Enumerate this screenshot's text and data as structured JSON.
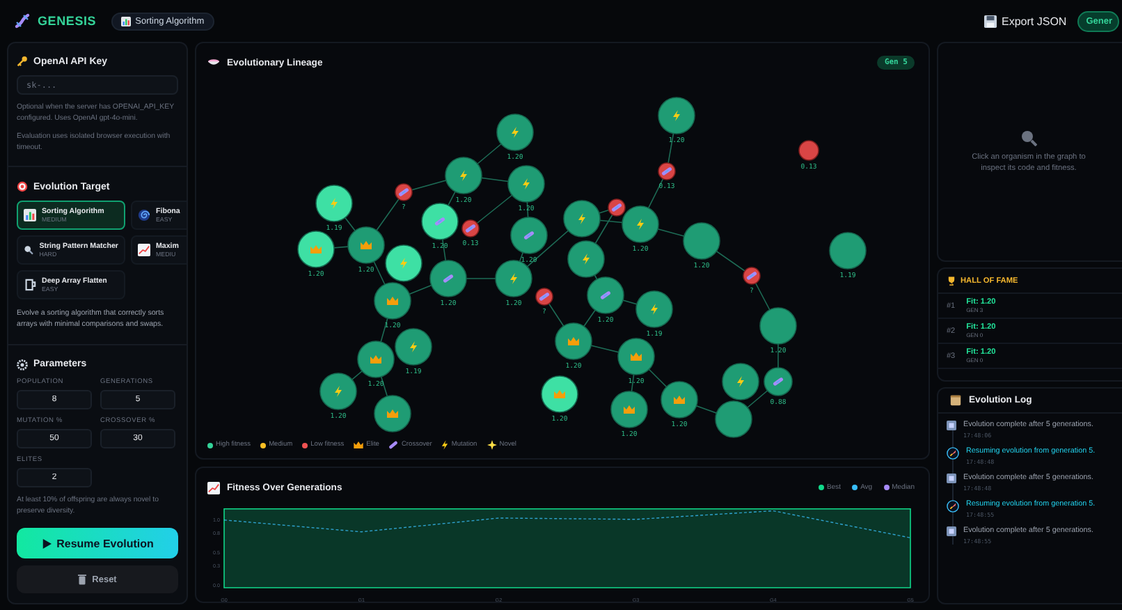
{
  "header": {
    "logo": "GENESIS",
    "task_chip": "Sorting Algorithm",
    "export_button": "Export JSON",
    "generate_button": "Gener"
  },
  "api_key": {
    "title": "OpenAI API Key",
    "placeholder": "sk-...",
    "help": "Optional when the server has OPENAI_API_KEY configured. Uses OpenAI gpt-4o-mini.",
    "note": "Evaluation uses isolated browser execution with timeout."
  },
  "target": {
    "title": "Evolution Target",
    "options": [
      {
        "name": "Sorting Algorithm",
        "difficulty": "MEDIUM",
        "selected": true
      },
      {
        "name": "Fibona",
        "difficulty": "EASY",
        "selected": false
      },
      {
        "name": "String Pattern Matcher",
        "difficulty": "HARD",
        "selected": false
      },
      {
        "name": "Maxim",
        "difficulty": "MEDIU",
        "selected": false
      },
      {
        "name": "Deep Array Flatten",
        "difficulty": "EASY",
        "selected": false
      }
    ],
    "description": "Evolve a sorting algorithm that correctly sorts arrays with minimal comparisons and swaps."
  },
  "parameters": {
    "title": "Parameters",
    "fields": [
      {
        "label": "POPULATION",
        "value": "8"
      },
      {
        "label": "GENERATIONS",
        "value": "5"
      },
      {
        "label": "MUTATION %",
        "value": "50"
      },
      {
        "label": "CROSSOVER %",
        "value": "30"
      },
      {
        "label": "ELITES",
        "value": "2"
      }
    ],
    "note": "At least 10% of offspring are always novel to preserve diversity."
  },
  "actions": {
    "resume": "Resume Evolution",
    "reset": "Reset"
  },
  "lineage": {
    "title": "Evolutionary Lineage",
    "generation_badge": "Gen 5",
    "nodes": [
      {
        "kind": "mutation",
        "low": false,
        "highlighted": false,
        "label": "1.20"
      },
      {
        "kind": "mutation",
        "low": false,
        "highlighted": false,
        "label": "1.20"
      },
      {
        "kind": "mutation",
        "low": false,
        "highlighted": false,
        "label": "1.20"
      },
      {
        "kind": "crossover",
        "low": true,
        "highlighted": false,
        "label": "?"
      },
      {
        "kind": "mutation",
        "low": false,
        "highlighted": true,
        "label": "1.19"
      },
      {
        "kind": "crossover",
        "low": false,
        "highlighted": true,
        "label": "1.20"
      },
      {
        "kind": "crossover",
        "low": true,
        "highlighted": false,
        "label": "0.13"
      },
      {
        "kind": "crossover",
        "low": false,
        "highlighted": false,
        "label": "1.20"
      },
      {
        "kind": "elite",
        "low": false,
        "highlighted": true,
        "label": "1.20"
      },
      {
        "kind": "elite",
        "low": false,
        "highlighted": false,
        "label": "1.20"
      },
      {
        "kind": "mutation",
        "low": false,
        "highlighted": true
      },
      {
        "kind": "crossover",
        "low": false,
        "highlighted": false,
        "label": "1.20"
      },
      {
        "kind": "mutation",
        "low": false,
        "highlighted": false,
        "label": "1.20"
      },
      {
        "kind": "crossover",
        "low": true,
        "highlighted": false,
        "label": "?"
      },
      {
        "kind": "elite",
        "low": false,
        "highlighted": false,
        "label": "1.20"
      },
      {
        "kind": "mutation",
        "low": false,
        "highlighted": false,
        "label": "1.19"
      },
      {
        "kind": "elite",
        "low": false,
        "highlighted": false,
        "label": "1.20"
      },
      {
        "kind": "mutation",
        "low": false,
        "highlighted": false,
        "label": "1.20"
      },
      {
        "kind": "elite",
        "low": false,
        "highlighted": false
      },
      {
        "kind": "mutation",
        "low": false,
        "highlighted": false,
        "label": "1.20"
      },
      {
        "kind": "crossover",
        "low": true,
        "highlighted": false,
        "label": "0.13"
      },
      {
        "kind": "none",
        "low": true,
        "highlighted": false,
        "label": "0.13"
      },
      {
        "kind": "mutation",
        "low": false,
        "highlighted": false
      },
      {
        "kind": "crossover",
        "low": true,
        "highlighted": false
      },
      {
        "kind": "mutation",
        "low": false,
        "highlighted": false,
        "label": "1.20"
      },
      {
        "kind": "mutation",
        "low": false,
        "highlighted": false
      },
      {
        "kind": "none",
        "low": false,
        "highlighted": false,
        "label": "1.20"
      },
      {
        "kind": "crossover",
        "low": true,
        "highlighted": false,
        "label": "?"
      },
      {
        "kind": "none",
        "low": false,
        "highlighted": false,
        "label": "1.19"
      },
      {
        "kind": "crossover",
        "low": false,
        "highlighted": false,
        "label": "1.20"
      },
      {
        "kind": "mutation",
        "low": false,
        "highlighted": false,
        "label": "1.19"
      },
      {
        "kind": "elite",
        "low": false,
        "highlighted": false,
        "label": "1.20"
      },
      {
        "kind": "elite",
        "low": false,
        "highlighted": false,
        "label": "1.20"
      },
      {
        "kind": "elite",
        "low": false,
        "highlighted": true,
        "label": "1.20"
      },
      {
        "kind": "elite",
        "low": false,
        "highlighted": false,
        "label": "1.20"
      },
      {
        "kind": "elite",
        "low": false,
        "highlighted": false,
        "label": "1.20"
      },
      {
        "kind": "mutation",
        "low": false,
        "highlighted": false
      },
      {
        "kind": "crossover",
        "low": false,
        "highlighted": false,
        "label": "0.88"
      },
      {
        "kind": "none",
        "low": false,
        "highlighted": false
      },
      {
        "kind": "none",
        "low": false,
        "highlighted": false,
        "label": "1.20"
      }
    ],
    "legend": [
      {
        "label": "High fitness",
        "kind": "dot",
        "color": "#34d399"
      },
      {
        "label": "Medium",
        "kind": "dot",
        "color": "#fbbf24"
      },
      {
        "label": "Low fitness",
        "kind": "dot",
        "color": "#f05252"
      },
      {
        "label": "Elite",
        "kind": "elite"
      },
      {
        "label": "Crossover",
        "kind": "crossover"
      },
      {
        "label": "Mutation",
        "kind": "mutation"
      },
      {
        "label": "Novel",
        "kind": "novel"
      }
    ]
  },
  "fitness": {
    "title": "Fitness Over Generations",
    "chart_data": {
      "type": "area",
      "categories": [
        "G0",
        "G1",
        "G2",
        "G3",
        "G4",
        "G5"
      ],
      "ylim": [
        0,
        1.25
      ],
      "yticks": [
        {
          "value": 0,
          "label": "0.0"
        },
        {
          "value": 0.3,
          "label": "0.3"
        },
        {
          "value": 0.5,
          "label": "0.5"
        },
        {
          "value": 0.8,
          "label": "0.8"
        },
        {
          "value": 1.0,
          "label": "1.0"
        }
      ],
      "series": [
        {
          "name": "Best",
          "color": "#10d98a",
          "values": [
            1.2,
            1.2,
            1.2,
            1.2,
            1.2,
            1.2
          ]
        },
        {
          "name": "Avg",
          "type": "line",
          "line_style": "dashed",
          "color": "#38bdf8",
          "values": [
            1.03,
            0.85,
            1.06,
            1.04,
            1.17,
            0.76
          ]
        },
        {
          "name": "Median",
          "type": "line",
          "color": "#a78bfa",
          "values": [
            null,
            null,
            null,
            null,
            null,
            null
          ]
        }
      ]
    }
  },
  "inspector": {
    "hint": "Click an organism in the graph to inspect its code and fitness."
  },
  "hall_of_fame": {
    "title": "HALL OF FAME",
    "entries": [
      {
        "rank": "#1",
        "fitness": "Fit: 1.20",
        "generation": "GEN 3"
      },
      {
        "rank": "#2",
        "fitness": "Fit: 1.20",
        "generation": "GEN 0"
      },
      {
        "rank": "#3",
        "fitness": "Fit: 1.20",
        "generation": "GEN 0"
      }
    ]
  },
  "log": {
    "title": "Evolution Log",
    "entries": [
      {
        "kind": "complete",
        "text": "Evolution complete after 5 generations.",
        "time": "17:48:06"
      },
      {
        "kind": "resume",
        "text": "Resuming evolution from generation 5.",
        "time": "17:48:48"
      },
      {
        "kind": "complete",
        "text": "Evolution complete after 5 generations.",
        "time": "17:48:48"
      },
      {
        "kind": "resume",
        "text": "Resuming evolution from generation 5.",
        "time": "17:48:55"
      },
      {
        "kind": "complete",
        "text": "Evolution complete after 5 generations.",
        "time": "17:48:55"
      }
    ]
  }
}
